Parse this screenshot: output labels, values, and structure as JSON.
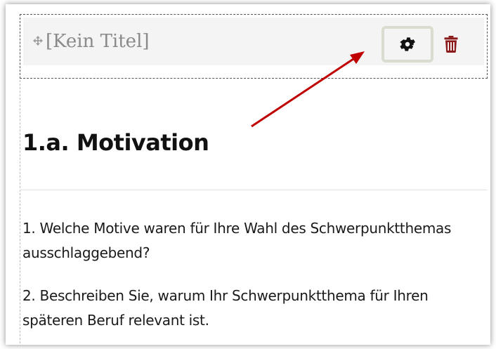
{
  "block": {
    "title": "[Kein Titel]",
    "move_icon": "move-arrows-icon",
    "settings_icon": "gear-icon",
    "delete_icon": "trash-icon",
    "accent_colors": {
      "delete": "#8b1a1a",
      "settings_highlight": "#d9ddd0",
      "annotation_arrow": "#c00000"
    }
  },
  "content": {
    "heading": "1.a. Motivation",
    "questions": [
      "1. Welche Motive waren für Ihre Wahl des Schwerpunktthemas ausschlaggebend?",
      "2. Beschreiben Sie, warum Ihr Schwerpunktthema für Ihren späteren Beruf relevant ist."
    ]
  }
}
